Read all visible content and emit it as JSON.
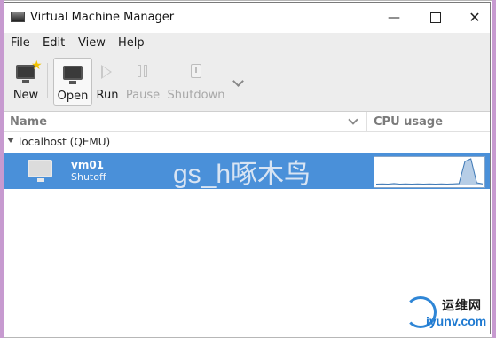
{
  "window": {
    "title": "Virtual Machine Manager"
  },
  "menubar": {
    "items": [
      "File",
      "Edit",
      "View",
      "Help"
    ]
  },
  "toolbar": {
    "new_label": "New",
    "open_label": "Open",
    "run_label": "Run",
    "pause_label": "Pause",
    "shutdown_label": "Shutdown"
  },
  "table": {
    "col_name": "Name",
    "col_cpu": "CPU usage"
  },
  "group": {
    "label": "localhost (QEMU)"
  },
  "vm": {
    "name": "vm01",
    "state": "Shutoff",
    "cpu_graph_points": [
      0.05,
      0.06,
      0.05,
      0.07,
      0.05,
      0.06,
      0.05,
      0.06,
      0.05,
      0.06,
      0.05,
      0.06,
      0.05,
      0.06,
      0.07,
      0.9,
      1.0,
      0.1,
      0.06
    ]
  },
  "watermark": {
    "text": "gs_h啄木鸟"
  },
  "brand": {
    "cn": "运维网",
    "en": "iyunv.com"
  },
  "colors": {
    "selection": "#4a90d9",
    "graph_line": "#3d78b5",
    "graph_fill": "#b6cde6"
  }
}
